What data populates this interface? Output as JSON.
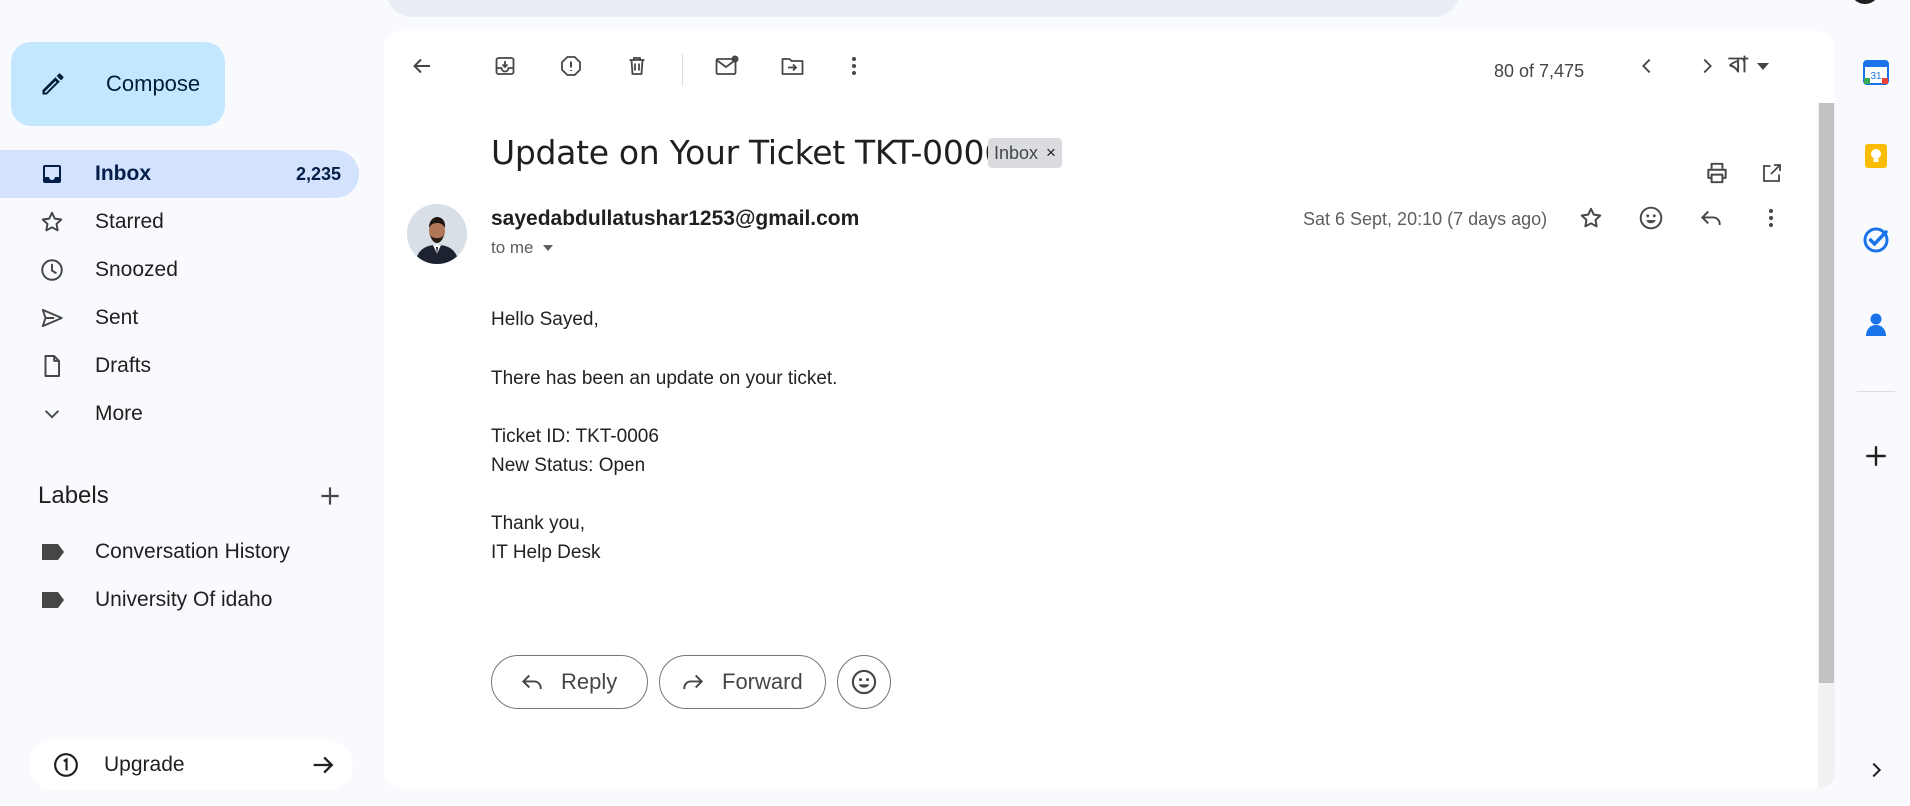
{
  "sidebar": {
    "compose_label": "Compose",
    "nav_items": [
      {
        "label": "Inbox",
        "count": "2,235",
        "icon": "inbox-icon"
      },
      {
        "label": "Starred",
        "icon": "star-icon"
      },
      {
        "label": "Snoozed",
        "icon": "clock-icon"
      },
      {
        "label": "Sent",
        "icon": "send-icon"
      },
      {
        "label": "Drafts",
        "icon": "draft-icon"
      },
      {
        "label": "More",
        "icon": "chevron-down-icon"
      }
    ],
    "labels_title": "Labels",
    "labels": [
      {
        "label": "Conversation History",
        "icon": "label-icon"
      },
      {
        "label": "University Of idaho",
        "icon": "label-icon"
      }
    ],
    "upgrade_label": "Upgrade"
  },
  "toolbar": {
    "pager": "80 of 7,475",
    "input_tool": "বা"
  },
  "email": {
    "subject": "Update on Your Ticket TKT-0006",
    "label_chip": "Inbox",
    "label_chip_close": "×",
    "sender": "sayedabdullatushar1253@gmail.com",
    "to": "to me",
    "date": "Sat 6 Sept, 20:10 (7 days ago)",
    "body": {
      "greeting": "Hello Sayed,",
      "line1": "There has been an update on your ticket.",
      "ticket_id": "Ticket ID: TKT-0006",
      "status": "New Status: Open",
      "closing": "Thank you,",
      "signature": "IT Help Desk"
    }
  },
  "actions": {
    "reply": "Reply",
    "forward": "Forward"
  },
  "side_panel": {
    "calendar_day": "31"
  },
  "colors": {
    "compose_bg": "#c2e7ff",
    "active_nav_bg": "#d3e3fd",
    "app_bg": "#f8fafd"
  }
}
